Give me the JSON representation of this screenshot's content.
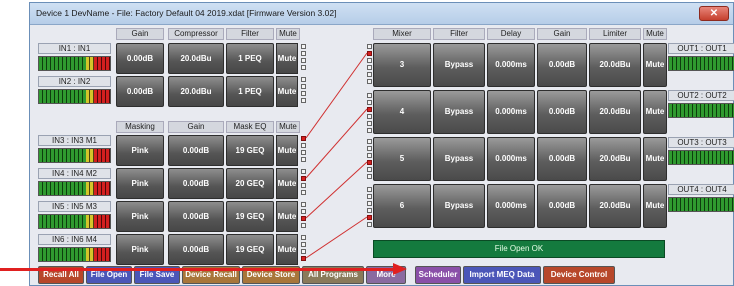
{
  "window": {
    "title": "Device 1 DevName  -  File: Factory Default 04 2019.xdat [Firmware Version 3.02]",
    "close_glyph": "✕"
  },
  "input_headers": {
    "gain": "Gain",
    "compressor": "Compressor",
    "filter": "Filter",
    "mute": "Mute"
  },
  "mic_headers": {
    "masking": "Masking",
    "gain": "Gain",
    "mask_eq": "Mask EQ",
    "mute": "Mute"
  },
  "inputs": [
    {
      "label": "IN1 : IN1",
      "gain": "0.00dB",
      "compressor": "20.0dBu",
      "filter": "1 PEQ",
      "mute": "Mute"
    },
    {
      "label": "IN2 : IN2",
      "gain": "0.00dB",
      "compressor": "20.0dBu",
      "filter": "1 PEQ",
      "mute": "Mute"
    }
  ],
  "mic_inputs": [
    {
      "label": "IN3 : IN3 M1",
      "masking": "Pink",
      "gain": "0.00dB",
      "mask_eq": "19 GEQ",
      "mute": "Mute"
    },
    {
      "label": "IN4 : IN4 M2",
      "masking": "Pink",
      "gain": "0.00dB",
      "mask_eq": "20 GEQ",
      "mute": "Mute"
    },
    {
      "label": "IN5 : IN5 M3",
      "masking": "Pink",
      "gain": "0.00dB",
      "mask_eq": "19 GEQ",
      "mute": "Mute"
    },
    {
      "label": "IN6 : IN6 M4",
      "masking": "Pink",
      "gain": "0.00dB",
      "mask_eq": "19 GEQ",
      "mute": "Mute"
    }
  ],
  "output_headers": {
    "mixer": "Mixer",
    "filter": "Filter",
    "delay": "Delay",
    "gain": "Gain",
    "limiter": "Limiter",
    "mute": "Mute"
  },
  "outputs": [
    {
      "mixer": "3",
      "filter": "Bypass",
      "delay": "0.000ms",
      "gain": "0.00dB",
      "limiter": "20.0dBu",
      "mute": "Mute",
      "label": "OUT1 : OUT1"
    },
    {
      "mixer": "4",
      "filter": "Bypass",
      "delay": "0.000ms",
      "gain": "0.00dB",
      "limiter": "20.0dBu",
      "mute": "Mute",
      "label": "OUT2 : OUT2"
    },
    {
      "mixer": "5",
      "filter": "Bypass",
      "delay": "0.000ms",
      "gain": "0.00dB",
      "limiter": "20.0dBu",
      "mute": "Mute",
      "label": "OUT3 : OUT3"
    },
    {
      "mixer": "6",
      "filter": "Bypass",
      "delay": "0.000ms",
      "gain": "0.00dB",
      "limiter": "20.0dBu",
      "mute": "Mute",
      "label": "OUT4 : OUT4"
    }
  ],
  "status": "File Open OK",
  "bottom_buttons": [
    {
      "label": "Recall All",
      "color": "#b7472a"
    },
    {
      "label": "File Open",
      "color": "#4b56b8"
    },
    {
      "label": "File Save",
      "color": "#4b56b8"
    },
    {
      "label": "Device Recall",
      "color": "#a8763a"
    },
    {
      "label": "Device Store",
      "color": "#a8763a"
    },
    {
      "label": "All Programs",
      "color": "#8a7a5a"
    },
    {
      "label": "More",
      "color": "#8a6aa0"
    },
    {
      "label": "Scheduler",
      "color": "#8a4fa8"
    },
    {
      "label": "Import MEQ Data",
      "color": "#4b56b8"
    },
    {
      "label": "Device Control",
      "color": "#b7472a"
    }
  ],
  "colors": {
    "annotation_arrow": "#e02020",
    "status_bg": "#147a3e"
  }
}
